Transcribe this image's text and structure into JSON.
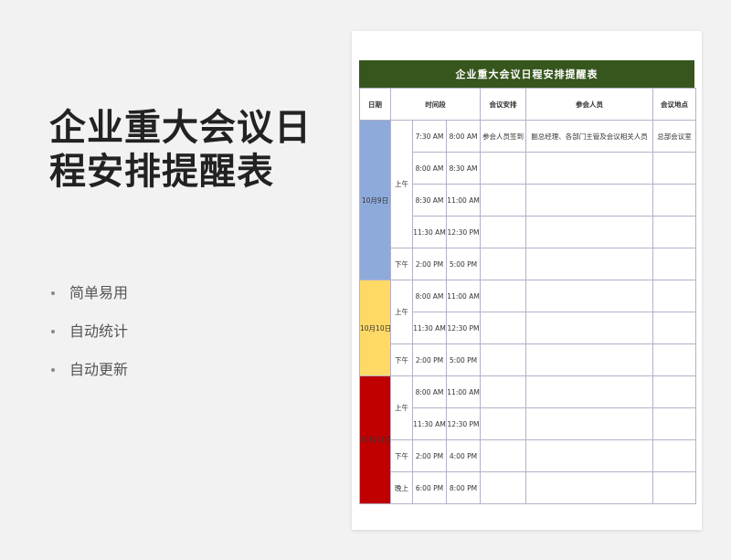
{
  "promo": {
    "title_lines": [
      "企业重大会议日",
      "程安排提醒表"
    ],
    "features": [
      "简单易用",
      "自动统计",
      "自动更新"
    ]
  },
  "sheet": {
    "title": "企业重大会议日程安排提醒表",
    "headers": {
      "date": "日期",
      "time": "时间段",
      "arrangement": "会议安排",
      "participants": "参会人员",
      "location": "会议地点"
    },
    "days": [
      {
        "date": "10月9日",
        "color": "#8eaadb",
        "periods": [
          {
            "label": "上午",
            "slots": [
              {
                "start": "7:30 AM",
                "end": "8:00 AM",
                "arrangement": "参会人员签到",
                "participants": "副总经理、各部门主管及会议相关人员",
                "location": "总部会议室"
              },
              {
                "start": "8:00 AM",
                "end": "8:30 AM",
                "arrangement": "",
                "participants": "",
                "location": ""
              },
              {
                "start": "8:30 AM",
                "end": "11:00 AM",
                "arrangement": "",
                "participants": "",
                "location": ""
              },
              {
                "start": "11:30 AM",
                "end": "12:30 PM",
                "arrangement": "",
                "participants": "",
                "location": ""
              }
            ]
          },
          {
            "label": "下午",
            "slots": [
              {
                "start": "2:00 PM",
                "end": "5:00 PM",
                "arrangement": "",
                "participants": "",
                "location": ""
              }
            ]
          }
        ]
      },
      {
        "date": "10月10日",
        "color": "#ffd966",
        "periods": [
          {
            "label": "上午",
            "slots": [
              {
                "start": "8:00 AM",
                "end": "11:00 AM",
                "arrangement": "",
                "participants": "",
                "location": ""
              },
              {
                "start": "11:30 AM",
                "end": "12:30 PM",
                "arrangement": "",
                "participants": "",
                "location": ""
              }
            ]
          },
          {
            "label": "下午",
            "slots": [
              {
                "start": "2:00 PM",
                "end": "5:00 PM",
                "arrangement": "",
                "participants": "",
                "location": ""
              }
            ]
          }
        ]
      },
      {
        "date": "10月11日",
        "color": "#c00000",
        "periods": [
          {
            "label": "上午",
            "slots": [
              {
                "start": "8:00 AM",
                "end": "11:00 AM",
                "arrangement": "",
                "participants": "",
                "location": ""
              },
              {
                "start": "11:30 AM",
                "end": "12:30 PM",
                "arrangement": "",
                "participants": "",
                "location": ""
              }
            ]
          },
          {
            "label": "下午",
            "slots": [
              {
                "start": "2:00 PM",
                "end": "4:00 PM",
                "arrangement": "",
                "participants": "",
                "location": ""
              }
            ]
          },
          {
            "label": "晚上",
            "slots": [
              {
                "start": "6:00 PM",
                "end": "8:00 PM",
                "arrangement": "",
                "participants": "",
                "location": ""
              }
            ]
          }
        ]
      }
    ]
  },
  "colors": {
    "title_bar": "#37561e",
    "grid": "#b5b0c8"
  }
}
